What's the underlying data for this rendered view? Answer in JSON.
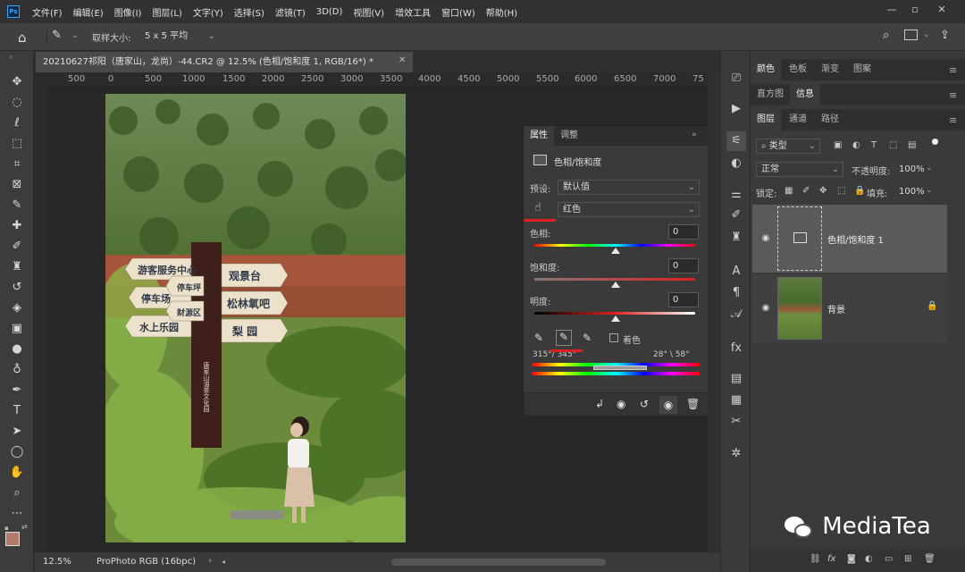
{
  "app": {
    "logo": "Ps",
    "menu": [
      "文件(F)",
      "编辑(E)",
      "图像(I)",
      "图层(L)",
      "文字(Y)",
      "选择(S)",
      "滤镜(T)",
      "3D(D)",
      "视图(V)",
      "增效工具",
      "窗口(W)",
      "帮助(H)"
    ]
  },
  "options_bar": {
    "sample_size_label": "取样大小:",
    "sample_size_value": "5 x 5 平均"
  },
  "document": {
    "tab_title": "20210627祁阳（唐家山，龙尚）-44.CR2 @ 12.5% (色相/饱和度 1, RGB/16*) *",
    "ruler_ticks": [
      "500",
      "0",
      "500",
      "1000",
      "1500",
      "2000",
      "2500",
      "3000",
      "3500",
      "4000",
      "4500",
      "5000",
      "5500",
      "6000",
      "6500",
      "7000",
      "75"
    ],
    "zoom": "12.5%",
    "color_profile": "ProPhoto RGB (16bpc)"
  },
  "photo": {
    "signs": [
      "游客服务中心",
      "停车场",
      "观景台",
      "停车坪",
      "松林氧吧",
      "财源区",
      "水上乐园",
      "梨 园"
    ],
    "post_text": "唐家山油茶文化园"
  },
  "properties": {
    "tabs": [
      "属性",
      "调整"
    ],
    "title": "色相/饱和度",
    "preset_label": "预设:",
    "preset_value": "默认值",
    "channel_value": "红色",
    "hue_label": "色相:",
    "hue_value": "0",
    "saturation_label": "饱和度:",
    "saturation_value": "0",
    "lightness_label": "明度:",
    "lightness_value": "0",
    "colorize_label": "着色",
    "range_left": "315°/ 345°",
    "range_right": "28° \\ 58°"
  },
  "right_panels": {
    "top_tabs": [
      "颜色",
      "色板",
      "渐变",
      "图案"
    ],
    "second_tabs": [
      "直方图",
      "信息"
    ],
    "layers_tabs": [
      "图层",
      "通道",
      "路径"
    ],
    "filter_kind": "类型",
    "blend_mode": "正常",
    "opacity_label": "不透明度:",
    "opacity_value": "100%",
    "lock_label": "锁定:",
    "fill_label": "填充:",
    "fill_value": "100%",
    "layers": [
      {
        "name": "色相/饱和度 1"
      },
      {
        "name": "背景"
      }
    ]
  },
  "watermark": "MediaTea",
  "colors": {
    "accent": "#31a8ff",
    "panel": "#3a3a3a",
    "canvas": "#282828"
  }
}
